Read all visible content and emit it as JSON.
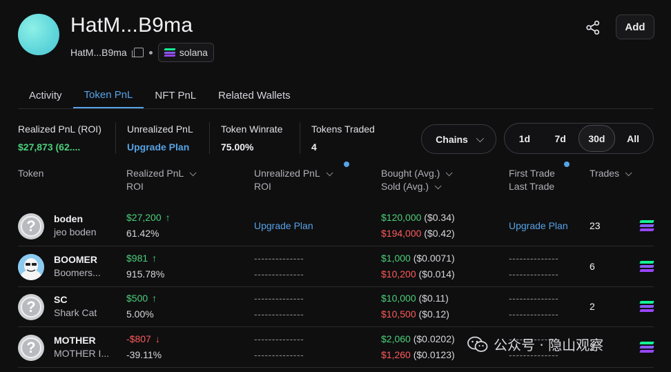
{
  "header": {
    "title": "HatM...B9ma",
    "address_short": "HatM...B9ma",
    "chain_label": "solana",
    "add_label": "Add"
  },
  "tabs": [
    {
      "label": "Activity",
      "active": false
    },
    {
      "label": "Token PnL",
      "active": true
    },
    {
      "label": "NFT PnL",
      "active": false
    },
    {
      "label": "Related Wallets",
      "active": false
    }
  ],
  "summary": {
    "realized": {
      "label": "Realized PnL (ROI)",
      "value": "$27,873 (62...."
    },
    "unrealized": {
      "label": "Unrealized PnL",
      "value": "Upgrade Plan"
    },
    "winrate": {
      "label": "Token Winrate",
      "value": "75.00%"
    },
    "traded": {
      "label": "Tokens Traded",
      "value": "4"
    }
  },
  "filters": {
    "chains_label": "Chains",
    "ranges": [
      {
        "label": "1d",
        "active": false
      },
      {
        "label": "7d",
        "active": false
      },
      {
        "label": "30d",
        "active": true
      },
      {
        "label": "All",
        "active": false
      }
    ]
  },
  "table": {
    "headers": {
      "token": "Token",
      "realized_pnl": "Realized PnL",
      "roi": "ROI",
      "unrealized_pnl": "Unrealized PnL",
      "unrealized_roi": "ROI",
      "bought": "Bought (Avg.)",
      "sold": "Sold (Avg.)",
      "first_trade": "First Trade",
      "last_trade": "Last Trade",
      "trades": "Trades"
    },
    "rows": [
      {
        "name": "boden",
        "sub": "jeo boden",
        "pnl": "$27,200",
        "pnl_arrow": "↑",
        "roi": "61.42%",
        "unrealized_top": "Upgrade Plan",
        "unrealized_bottom": "",
        "bought": "$120,000",
        "bought_avg": "($0.34)",
        "sold": "$194,000",
        "sold_avg": "($0.42)",
        "first_top": "Upgrade Plan",
        "first_bottom": "",
        "trades": "23",
        "pnl_color": "green"
      },
      {
        "name": "BOOMER",
        "sub": "Boomers...",
        "pnl": "$981",
        "pnl_arrow": "↑",
        "roi": "915.78%",
        "unrealized_top": "--------------",
        "unrealized_bottom": "--------------",
        "bought": "$1,000",
        "bought_avg": "($0.0071)",
        "sold": "$10,200",
        "sold_avg": "($0.014)",
        "first_top": "--------------",
        "first_bottom": "--------------",
        "trades": "6",
        "pnl_color": "green"
      },
      {
        "name": "SC",
        "sub": "Shark Cat",
        "pnl": "$500",
        "pnl_arrow": "↑",
        "roi": "5.00%",
        "unrealized_top": "--------------",
        "unrealized_bottom": "--------------",
        "bought": "$10,000",
        "bought_avg": "($0.11)",
        "sold": "$10,500",
        "sold_avg": "($0.12)",
        "first_top": "--------------",
        "first_bottom": "--------------",
        "trades": "2",
        "pnl_color": "green"
      },
      {
        "name": "MOTHER",
        "sub": "MOTHER I...",
        "pnl": "-$807",
        "pnl_arrow": "↓",
        "roi": "-39.11%",
        "unrealized_top": "--------------",
        "unrealized_bottom": "--------------",
        "bought": "$2,060",
        "bought_avg": "($0.0202)",
        "sold": "$1,260",
        "sold_avg": "($0.0123)",
        "first_top": "--------------",
        "first_bottom": "--------------",
        "trades": "2",
        "pnl_color": "red"
      }
    ]
  },
  "watermark": {
    "text": "公众号 · 隐山观察"
  },
  "colors": {
    "accent": "#57a3e6",
    "positive": "#4cd07a",
    "negative": "#ff5a5a",
    "background": "#0f0f10"
  }
}
